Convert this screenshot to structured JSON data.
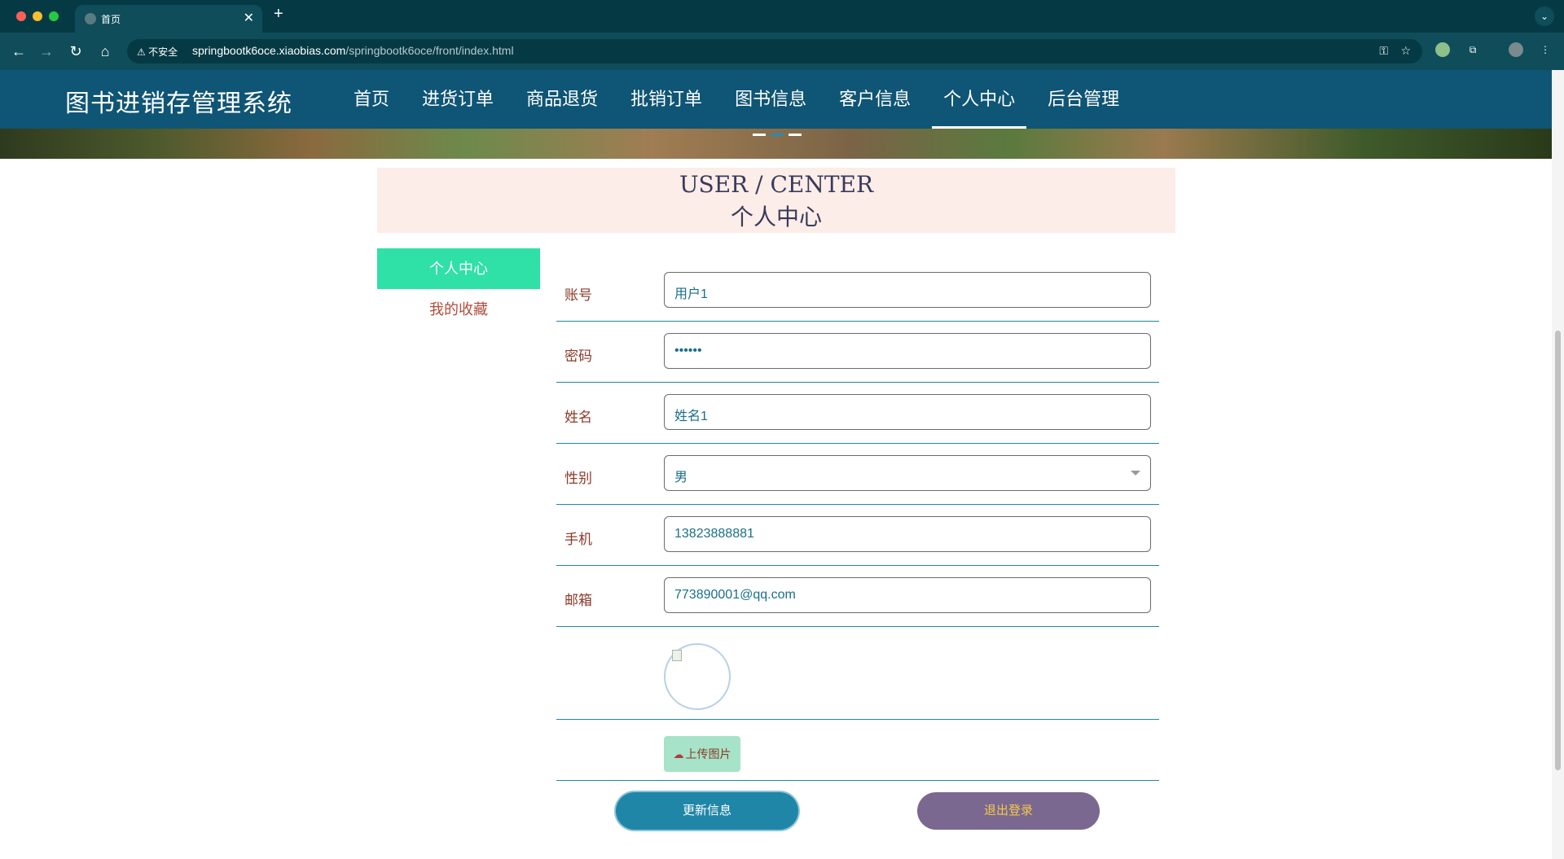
{
  "browser": {
    "tab_title": "首页",
    "tab_close": "✕",
    "new_tab": "+",
    "insecure_label": "⚠ 不安全",
    "url_host": "springbootk6oce.xiaobias.com",
    "url_path": "/springbootk6oce/front/index.html"
  },
  "site": {
    "title": "图书进销存管理系统",
    "nav": [
      "首页",
      "进货订单",
      "商品退货",
      "批销订单",
      "图书信息",
      "客户信息",
      "个人中心",
      "后台管理"
    ],
    "active_nav": "个人中心"
  },
  "section": {
    "title_en": "USER / CENTER",
    "title_cn": "个人中心"
  },
  "sidebar": {
    "items": [
      "个人中心",
      "我的收藏"
    ]
  },
  "form": {
    "account": {
      "label": "账号",
      "value": "用户1"
    },
    "password": {
      "label": "密码",
      "value": "••••••"
    },
    "name": {
      "label": "姓名",
      "value": "姓名1"
    },
    "gender": {
      "label": "性别",
      "value": "男"
    },
    "phone": {
      "label": "手机",
      "value": "13823888881"
    },
    "email": {
      "label": "邮箱",
      "value": "773890001@qq.com"
    },
    "upload_label": "上传图片",
    "update_button": "更新信息",
    "logout_button": "退出登录"
  },
  "colors": {
    "header_bg": "#0f5575",
    "sidebar_active": "#2fe0a7",
    "update_btn": "#1f86a8",
    "logout_btn": "#7a6890"
  }
}
